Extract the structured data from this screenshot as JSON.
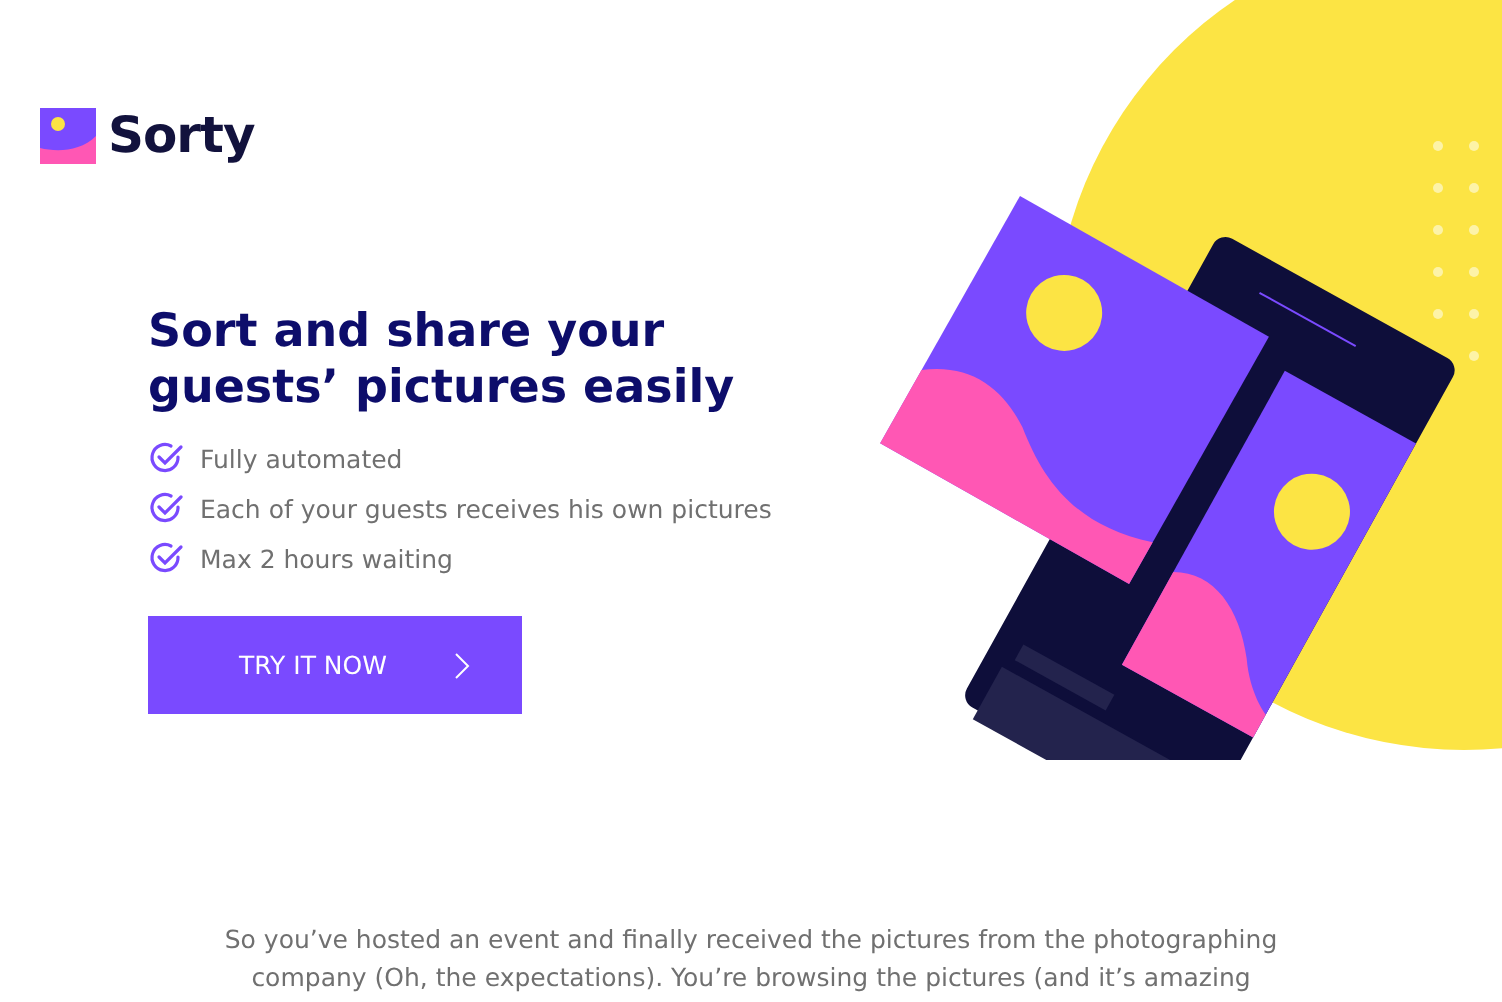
{
  "brand": {
    "name": "Sorty"
  },
  "hero": {
    "title_lines": [
      "Sort and share your",
      "guests’ pictures easily"
    ],
    "features": [
      "Fully automated",
      "Each of your guests receives his own pictures",
      "Max 2 hours waiting"
    ],
    "cta": {
      "label": "TRY IT NOW"
    }
  },
  "intro": {
    "lines": [
      "So you’ve hosted an event and finally received the pictures from the photographing",
      "company (Oh, the expectations). You’re browsing the pictures (and it’s amazing"
    ]
  }
}
